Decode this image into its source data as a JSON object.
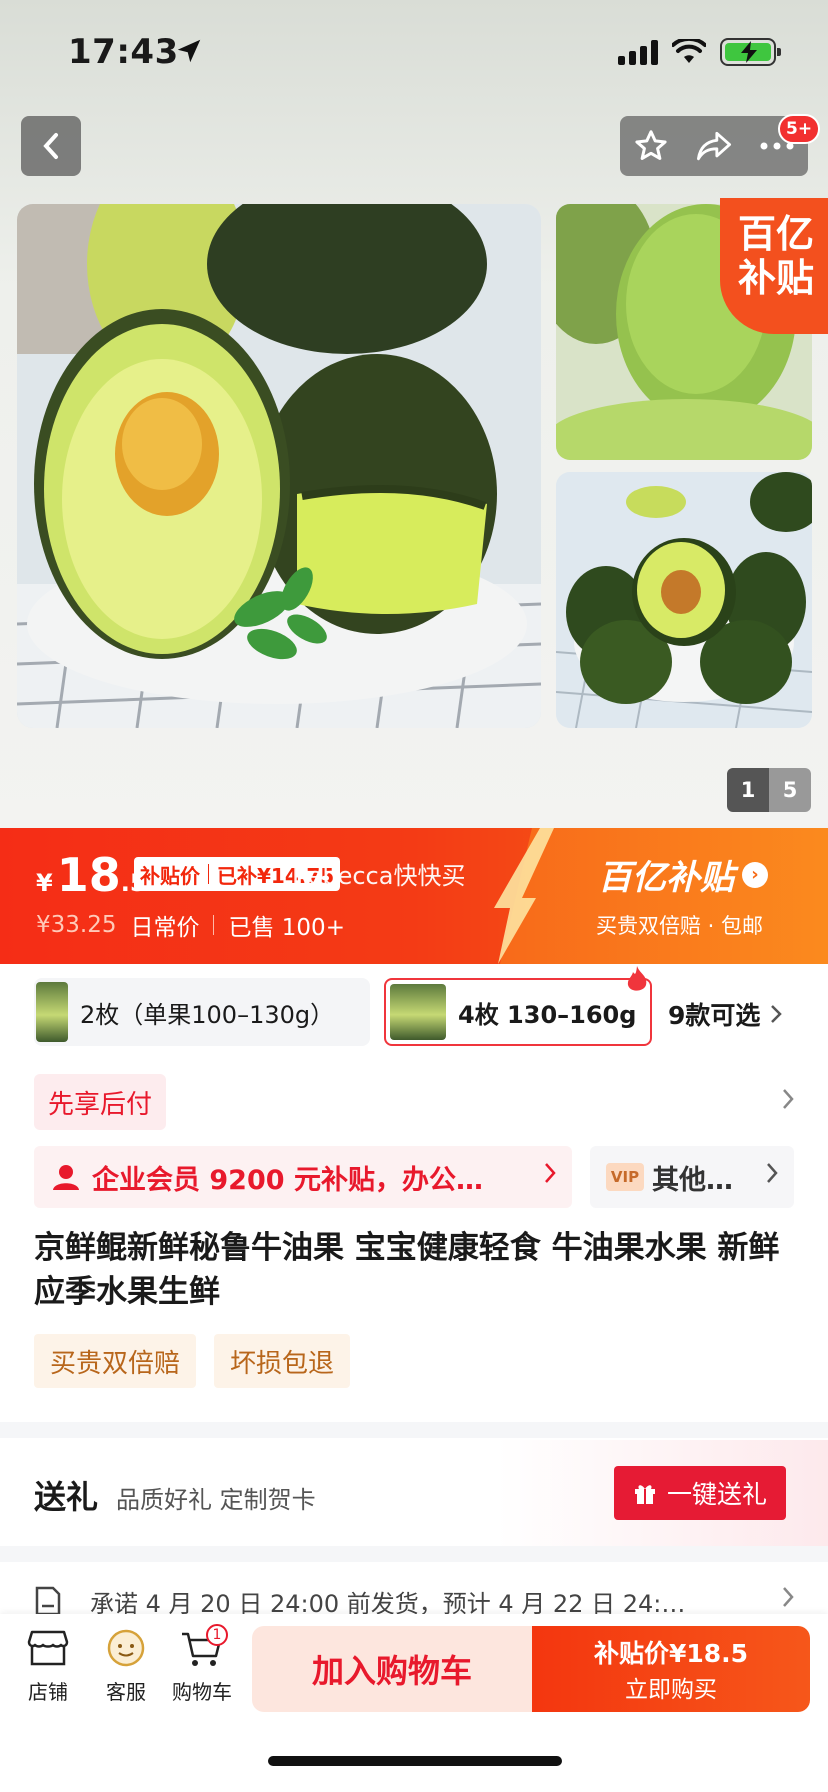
{
  "status_bar": {
    "time": "17:43"
  },
  "header": {
    "badge": "5+"
  },
  "gallery": {
    "subsidy_corner_line1": "百亿",
    "subsidy_corner_line2": "补贴",
    "current_page": "1",
    "total_pages": "5"
  },
  "price_banner": {
    "currency": "¥",
    "price_int": "18",
    "price_dec": ".5",
    "tag_subsidy_price": "补贴价",
    "tag_subsidized": "已补¥14.75",
    "seller_name": "Rebecca快快买",
    "old_price": "¥33.25",
    "daily_price_label": "日常价",
    "sold": "已售 100+",
    "subsidy_logo": "百亿补贴",
    "subsidy_sub": "买贵双倍赔 · 包邮"
  },
  "variants": {
    "option_1": "2枚（单果100–130g）",
    "option_2": "4枚 130–160g",
    "more": "9款可选"
  },
  "pay_later": "先享后付",
  "promos": {
    "enterprise": "企业会员 9200 元补贴，办公…",
    "vip_label": "VIP",
    "other": "其他…"
  },
  "product": {
    "title": "京鲜鲲新鲜秘鲁牛油果  宝宝健康轻食 牛油果水果 新鲜应季水果生鲜",
    "tags": [
      "买贵双倍赔",
      "坏损包退"
    ]
  },
  "gift": {
    "title": "送礼",
    "subtitle": "品质好礼 定制贺卡",
    "button": "一键送礼"
  },
  "shipping": {
    "text": "承诺 4 月 20 日 24:00 前发货，预计 4 月 22 日 24:…"
  },
  "bottom_bar": {
    "shop": "店铺",
    "service": "客服",
    "cart": "购物车",
    "cart_count": "1",
    "add_to_cart": "加入购物车",
    "buy_price": "补贴价¥18.5",
    "buy_now": "立即购买"
  },
  "colors": {
    "accent": "#f2270c",
    "subsidy_orange": "#f66a16"
  }
}
